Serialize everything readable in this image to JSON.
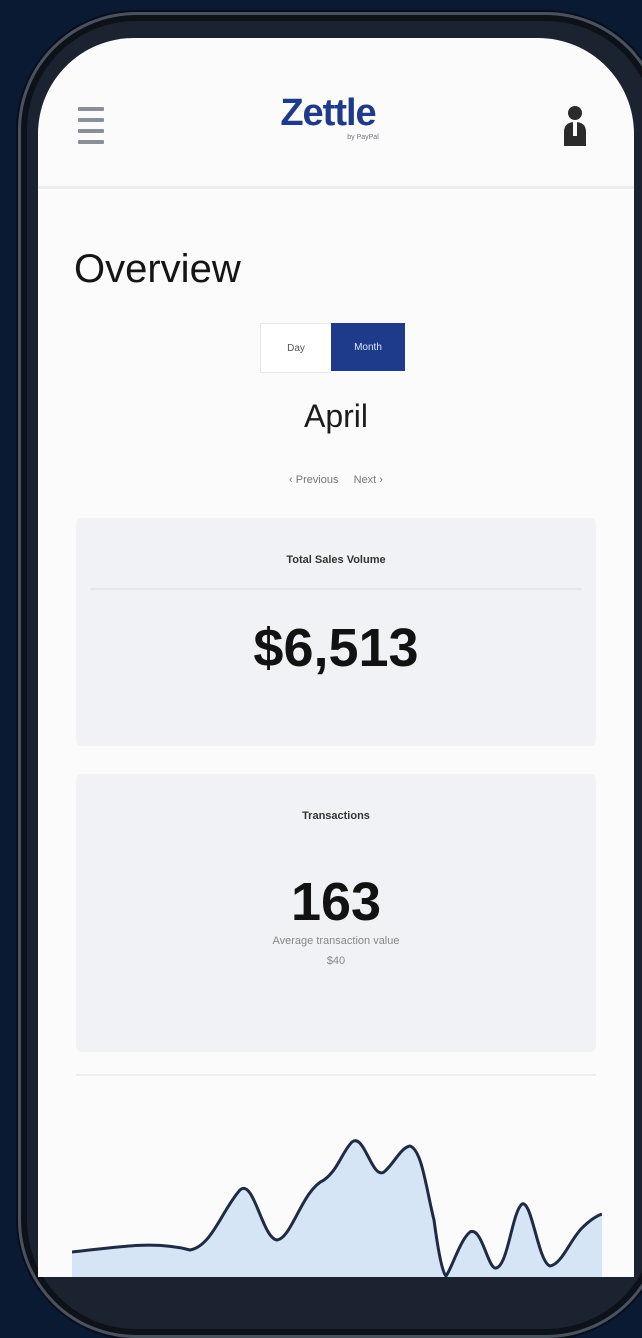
{
  "app": {
    "logo_text": "Zettle",
    "logo_subtext": "by PayPal"
  },
  "icons": {
    "menu": "hamburger-menu-icon",
    "user": "user-icon"
  },
  "overview": {
    "title": "Overview"
  },
  "toggle": {
    "options": [
      "Day",
      "Month"
    ],
    "selected": "Month"
  },
  "period": {
    "label": "April",
    "previous_label": "‹ Previous",
    "next_label": "Next ›"
  },
  "cards": {
    "sales": {
      "label": "Total Sales Volume",
      "value": "$6,513"
    },
    "transactions": {
      "label": "Transactions",
      "value": "163",
      "subtext_line1": "Average transaction value",
      "subtext_line2": "$40"
    }
  },
  "colors": {
    "accent": "#1e3a8a",
    "background": "#0b1a33",
    "chart_fill": "#cfe0f5",
    "chart_line": "#1f2a44"
  }
}
